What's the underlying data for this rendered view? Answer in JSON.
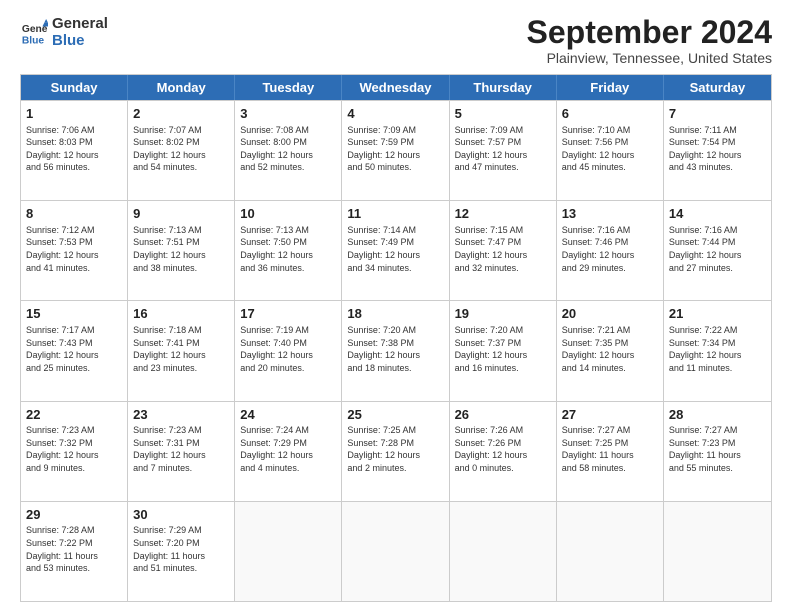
{
  "header": {
    "logo_line1": "General",
    "logo_line2": "Blue",
    "title": "September 2024",
    "location": "Plainview, Tennessee, United States"
  },
  "days_of_week": [
    "Sunday",
    "Monday",
    "Tuesday",
    "Wednesday",
    "Thursday",
    "Friday",
    "Saturday"
  ],
  "weeks": [
    [
      {
        "day": 1,
        "lines": [
          "Sunrise: 7:06 AM",
          "Sunset: 8:03 PM",
          "Daylight: 12 hours",
          "and 56 minutes."
        ]
      },
      {
        "day": 2,
        "lines": [
          "Sunrise: 7:07 AM",
          "Sunset: 8:02 PM",
          "Daylight: 12 hours",
          "and 54 minutes."
        ]
      },
      {
        "day": 3,
        "lines": [
          "Sunrise: 7:08 AM",
          "Sunset: 8:00 PM",
          "Daylight: 12 hours",
          "and 52 minutes."
        ]
      },
      {
        "day": 4,
        "lines": [
          "Sunrise: 7:09 AM",
          "Sunset: 7:59 PM",
          "Daylight: 12 hours",
          "and 50 minutes."
        ]
      },
      {
        "day": 5,
        "lines": [
          "Sunrise: 7:09 AM",
          "Sunset: 7:57 PM",
          "Daylight: 12 hours",
          "and 47 minutes."
        ]
      },
      {
        "day": 6,
        "lines": [
          "Sunrise: 7:10 AM",
          "Sunset: 7:56 PM",
          "Daylight: 12 hours",
          "and 45 minutes."
        ]
      },
      {
        "day": 7,
        "lines": [
          "Sunrise: 7:11 AM",
          "Sunset: 7:54 PM",
          "Daylight: 12 hours",
          "and 43 minutes."
        ]
      }
    ],
    [
      {
        "day": 8,
        "lines": [
          "Sunrise: 7:12 AM",
          "Sunset: 7:53 PM",
          "Daylight: 12 hours",
          "and 41 minutes."
        ]
      },
      {
        "day": 9,
        "lines": [
          "Sunrise: 7:13 AM",
          "Sunset: 7:51 PM",
          "Daylight: 12 hours",
          "and 38 minutes."
        ]
      },
      {
        "day": 10,
        "lines": [
          "Sunrise: 7:13 AM",
          "Sunset: 7:50 PM",
          "Daylight: 12 hours",
          "and 36 minutes."
        ]
      },
      {
        "day": 11,
        "lines": [
          "Sunrise: 7:14 AM",
          "Sunset: 7:49 PM",
          "Daylight: 12 hours",
          "and 34 minutes."
        ]
      },
      {
        "day": 12,
        "lines": [
          "Sunrise: 7:15 AM",
          "Sunset: 7:47 PM",
          "Daylight: 12 hours",
          "and 32 minutes."
        ]
      },
      {
        "day": 13,
        "lines": [
          "Sunrise: 7:16 AM",
          "Sunset: 7:46 PM",
          "Daylight: 12 hours",
          "and 29 minutes."
        ]
      },
      {
        "day": 14,
        "lines": [
          "Sunrise: 7:16 AM",
          "Sunset: 7:44 PM",
          "Daylight: 12 hours",
          "and 27 minutes."
        ]
      }
    ],
    [
      {
        "day": 15,
        "lines": [
          "Sunrise: 7:17 AM",
          "Sunset: 7:43 PM",
          "Daylight: 12 hours",
          "and 25 minutes."
        ]
      },
      {
        "day": 16,
        "lines": [
          "Sunrise: 7:18 AM",
          "Sunset: 7:41 PM",
          "Daylight: 12 hours",
          "and 23 minutes."
        ]
      },
      {
        "day": 17,
        "lines": [
          "Sunrise: 7:19 AM",
          "Sunset: 7:40 PM",
          "Daylight: 12 hours",
          "and 20 minutes."
        ]
      },
      {
        "day": 18,
        "lines": [
          "Sunrise: 7:20 AM",
          "Sunset: 7:38 PM",
          "Daylight: 12 hours",
          "and 18 minutes."
        ]
      },
      {
        "day": 19,
        "lines": [
          "Sunrise: 7:20 AM",
          "Sunset: 7:37 PM",
          "Daylight: 12 hours",
          "and 16 minutes."
        ]
      },
      {
        "day": 20,
        "lines": [
          "Sunrise: 7:21 AM",
          "Sunset: 7:35 PM",
          "Daylight: 12 hours",
          "and 14 minutes."
        ]
      },
      {
        "day": 21,
        "lines": [
          "Sunrise: 7:22 AM",
          "Sunset: 7:34 PM",
          "Daylight: 12 hours",
          "and 11 minutes."
        ]
      }
    ],
    [
      {
        "day": 22,
        "lines": [
          "Sunrise: 7:23 AM",
          "Sunset: 7:32 PM",
          "Daylight: 12 hours",
          "and 9 minutes."
        ]
      },
      {
        "day": 23,
        "lines": [
          "Sunrise: 7:23 AM",
          "Sunset: 7:31 PM",
          "Daylight: 12 hours",
          "and 7 minutes."
        ]
      },
      {
        "day": 24,
        "lines": [
          "Sunrise: 7:24 AM",
          "Sunset: 7:29 PM",
          "Daylight: 12 hours",
          "and 4 minutes."
        ]
      },
      {
        "day": 25,
        "lines": [
          "Sunrise: 7:25 AM",
          "Sunset: 7:28 PM",
          "Daylight: 12 hours",
          "and 2 minutes."
        ]
      },
      {
        "day": 26,
        "lines": [
          "Sunrise: 7:26 AM",
          "Sunset: 7:26 PM",
          "Daylight: 12 hours",
          "and 0 minutes."
        ]
      },
      {
        "day": 27,
        "lines": [
          "Sunrise: 7:27 AM",
          "Sunset: 7:25 PM",
          "Daylight: 11 hours",
          "and 58 minutes."
        ]
      },
      {
        "day": 28,
        "lines": [
          "Sunrise: 7:27 AM",
          "Sunset: 7:23 PM",
          "Daylight: 11 hours",
          "and 55 minutes."
        ]
      }
    ],
    [
      {
        "day": 29,
        "lines": [
          "Sunrise: 7:28 AM",
          "Sunset: 7:22 PM",
          "Daylight: 11 hours",
          "and 53 minutes."
        ]
      },
      {
        "day": 30,
        "lines": [
          "Sunrise: 7:29 AM",
          "Sunset: 7:20 PM",
          "Daylight: 11 hours",
          "and 51 minutes."
        ]
      },
      {
        "day": null,
        "lines": []
      },
      {
        "day": null,
        "lines": []
      },
      {
        "day": null,
        "lines": []
      },
      {
        "day": null,
        "lines": []
      },
      {
        "day": null,
        "lines": []
      }
    ]
  ]
}
